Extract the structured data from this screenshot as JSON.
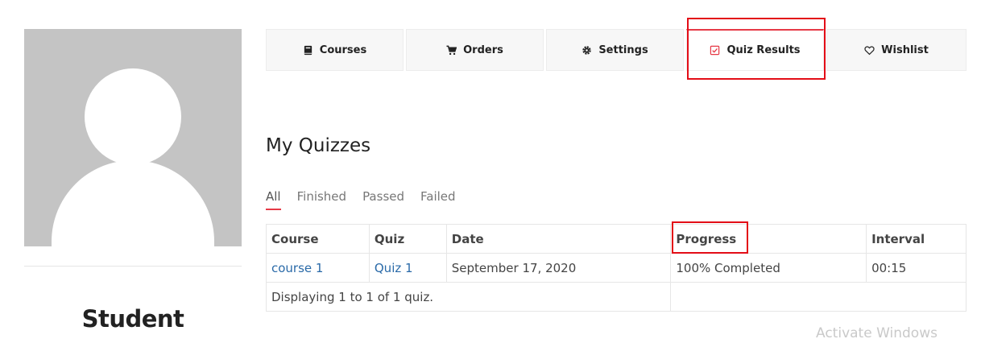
{
  "profile": {
    "name": "Student"
  },
  "tabs": [
    {
      "label": "Courses",
      "icon": "book-icon"
    },
    {
      "label": "Orders",
      "icon": "cart-icon"
    },
    {
      "label": "Settings",
      "icon": "gear-icon"
    },
    {
      "label": "Quiz Results",
      "icon": "checkbox-icon",
      "active": true
    },
    {
      "label": "Wishlist",
      "icon": "heart-icon"
    }
  ],
  "main": {
    "heading": "My Quizzes",
    "filters": [
      "All",
      "Finished",
      "Passed",
      "Failed"
    ],
    "active_filter": "All"
  },
  "table": {
    "headers": [
      "Course",
      "Quiz",
      "Date",
      "Progress",
      "Interval"
    ],
    "rows": [
      {
        "course": "course 1",
        "quiz": "Quiz 1",
        "date": "September 17, 2020",
        "progress": "100% Completed",
        "interval": "00:15"
      }
    ],
    "footer": "Displaying 1 to 1 of 1 quiz."
  },
  "colors": {
    "accent": "#e63946",
    "annotation": "#e30d17",
    "link": "#2a6aa8"
  },
  "watermark": "Activate Windows"
}
